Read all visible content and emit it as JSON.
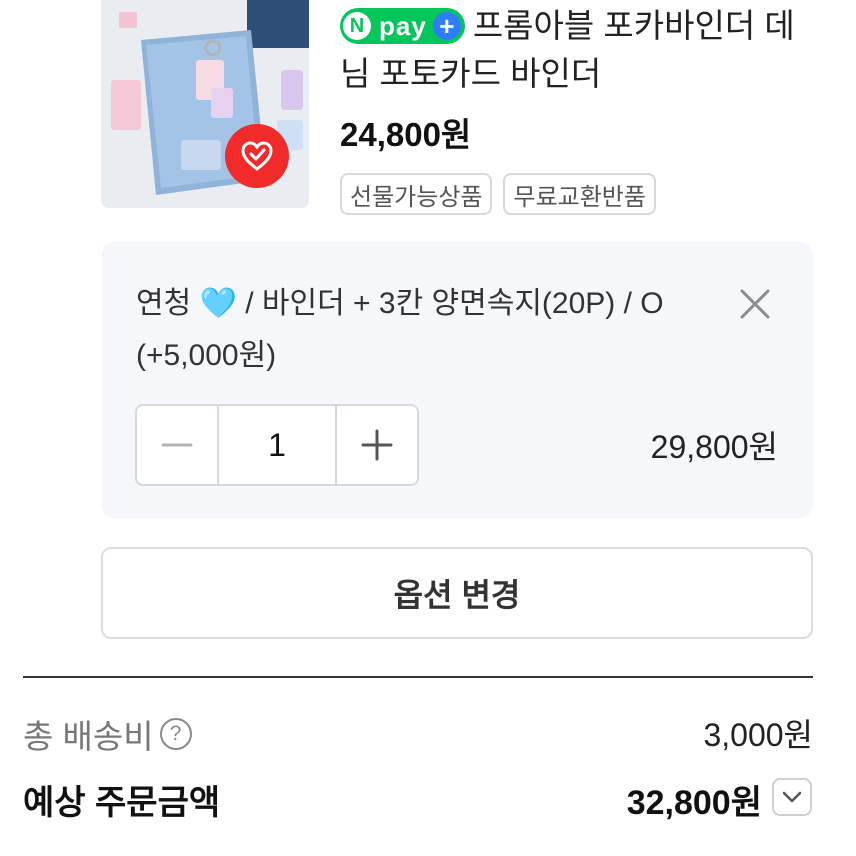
{
  "product": {
    "npay_badge": {
      "n": "N",
      "label": "pay",
      "plus": "+"
    },
    "title": "프롬아블 포카바인더 데님 포토카드 바인더",
    "price": "24,800원",
    "tags": [
      "선물가능상품",
      "무료교환반품"
    ],
    "image_icon": "heart-check-icon"
  },
  "option": {
    "text_before_emoji": "연청 ",
    "emoji": "🩵",
    "text_after_emoji": " / 바인더 + 3칸 양면속지(20P) / O (+5,000원)",
    "quantity": "1",
    "price": "29,800원"
  },
  "change_option_label": "옵션 변경",
  "summary": {
    "shipping_label": "총 배송비",
    "help_icon": "?",
    "shipping_value": "3,000원",
    "total_label": "예상 주문금액",
    "total_value": "32,800원"
  },
  "colors": {
    "npay_green": "#03c75a",
    "plus_blue": "#2e7dff",
    "badge_red": "#f12a2a",
    "option_bg": "#f5f7fa"
  }
}
